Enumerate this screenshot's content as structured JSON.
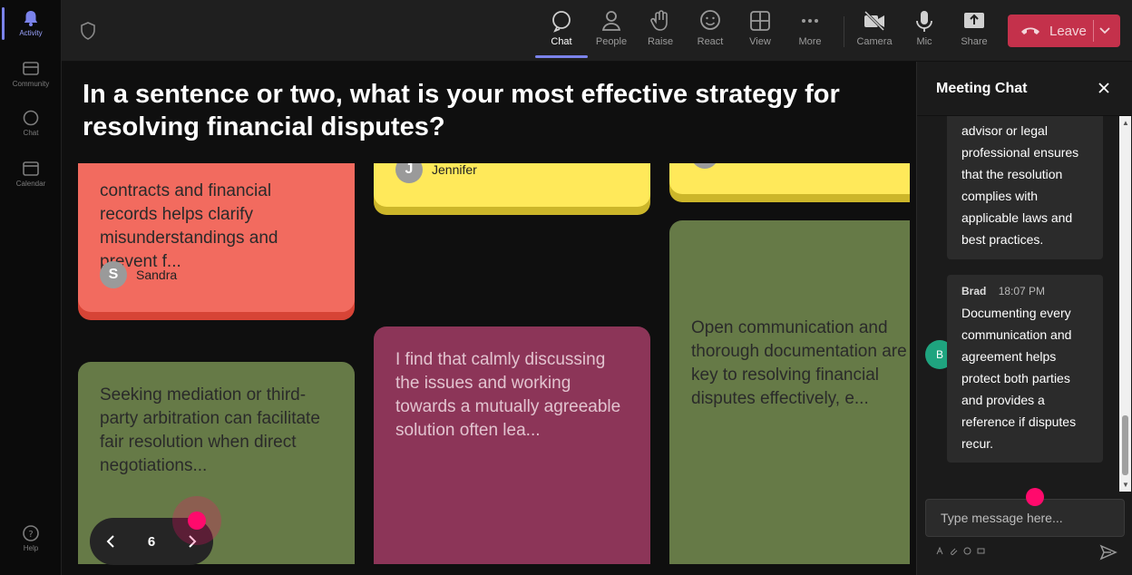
{
  "rail": {
    "items": [
      {
        "label": "Activity",
        "icon": "bell-icon",
        "active": true
      },
      {
        "label": "Community",
        "icon": "community-icon"
      },
      {
        "label": "Chat",
        "icon": "chat-icon"
      },
      {
        "label": "Calendar",
        "icon": "calendar-icon"
      },
      {
        "label": "Help",
        "icon": "help-icon"
      }
    ]
  },
  "toolbar": {
    "buttons": [
      {
        "label": "Chat",
        "icon": "chat-bubble-icon",
        "active": true
      },
      {
        "label": "People",
        "icon": "people-icon"
      },
      {
        "label": "Raise",
        "icon": "raise-hand-icon"
      },
      {
        "label": "React",
        "icon": "react-smiley-icon"
      },
      {
        "label": "View",
        "icon": "view-grid-icon"
      },
      {
        "label": "More",
        "icon": "more-dots-icon"
      },
      {
        "label": "Camera",
        "icon": "camera-off-icon"
      },
      {
        "label": "Mic",
        "icon": "mic-icon"
      },
      {
        "label": "Share",
        "icon": "share-icon"
      }
    ],
    "leave_label": "Leave",
    "leave_color": "#c4314b"
  },
  "board": {
    "question": "In a sentence or two, what is your most effective strategy for resolving financial disputes?",
    "notes": [
      {
        "color": "red",
        "text": "contracts and financial records helps clarify misunderstandings and prevent f...",
        "author": "Sandra",
        "initial": "S"
      },
      {
        "color": "yellow",
        "text": "",
        "author": "Jennifer",
        "initial": "J"
      },
      {
        "color": "yellow",
        "text": "",
        "author": "",
        "initial": ""
      },
      {
        "color": "green",
        "text": "Seeking mediation or third-party arbitration can facilitate fair resolution when direct negotiations..."
      },
      {
        "color": "plum",
        "text": "I find that calmly discussing the issues and working towards a mutually agreeable solution often lea..."
      },
      {
        "color": "green",
        "text": "Open communication and thorough documentation are key to resolving financial disputes effectively, e..."
      }
    ],
    "colors": {
      "red": "#f26b5f",
      "yellow": "#ffe95a",
      "green": "#667a47",
      "plum": "#8c3558"
    }
  },
  "pager": {
    "page": "6"
  },
  "chat": {
    "title": "Meeting Chat",
    "messages": [
      {
        "text": "advisor or legal professional ensures that the resolution complies with applicable laws and best practices."
      },
      {
        "author": "Brad",
        "initial": "B",
        "time": "18:07 PM",
        "text": "Documenting every communication and agreement helps protect both parties and provides a reference if disputes recur."
      }
    ],
    "input_placeholder": "Type message here..."
  },
  "accent": "#7b83eb",
  "highlight_dot": "#ff0a6c"
}
